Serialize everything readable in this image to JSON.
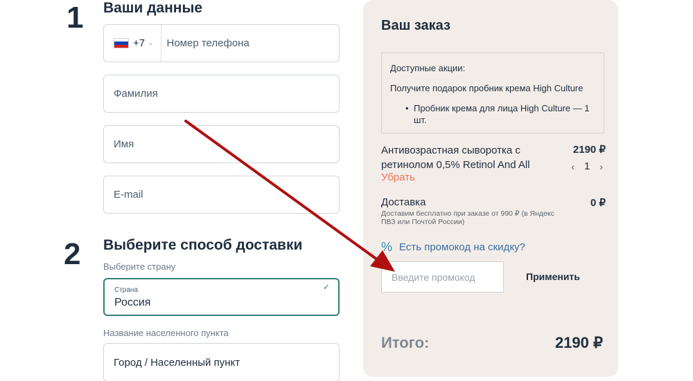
{
  "steps": {
    "one": {
      "number": "1",
      "title": "Ваши данные"
    },
    "two": {
      "number": "2",
      "title": "Выберите способ доставки"
    }
  },
  "contact": {
    "phone_code": "+7",
    "phone_placeholder": "Номер телефона",
    "last_name_placeholder": "Фамилия",
    "first_name_placeholder": "Имя",
    "email_placeholder": "E-mail"
  },
  "delivery": {
    "country_prompt": "Выберите страну",
    "country_field_label": "Страна",
    "country_value": "Россия",
    "city_prompt": "Название населенного пункта",
    "city_placeholder": "Город / Населенный пункт"
  },
  "order": {
    "title": "Ваш заказ",
    "promotions": {
      "header": "Доступные акции:",
      "offer": "Получите подарок пробник крема High Culture",
      "items": [
        "Пробник крема для лица High Culture — 1 шт."
      ]
    },
    "product": {
      "name": "Антивозрастная сыворотка с ретинолом 0,5% Retinol And All",
      "price": "2190 ₽",
      "quantity": "1",
      "remove_label": "Убрать"
    },
    "shipping": {
      "label": "Доставка",
      "note": "Доставим бесплатно при заказе от 990 ₽ (в Яндекс ПВЗ или Почтой России)",
      "price": "0 ₽"
    },
    "promo_link": "Есть промокод на скидку?",
    "promo_placeholder": "Введите промокод",
    "apply_label": "Применить",
    "total_label": "Итого:",
    "total_value": "2190 ₽"
  },
  "colors": {
    "accent": "#2f7f7a",
    "panel_bg": "#f3ede9",
    "remove": "#e8765a",
    "annotation_arrow": "#b01010"
  }
}
